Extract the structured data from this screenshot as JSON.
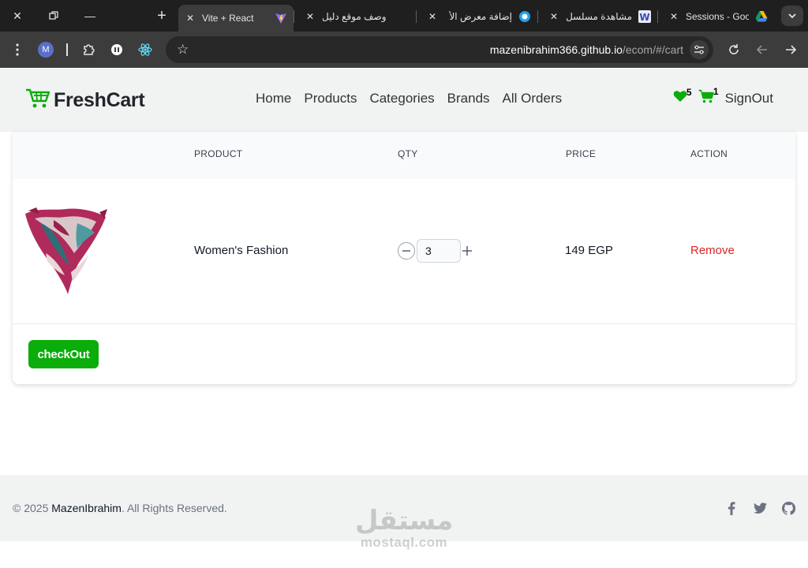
{
  "browser": {
    "tabs": [
      {
        "title": "Vite + React",
        "active": true
      },
      {
        "title": "وصف موقع دليل",
        "active": false
      },
      {
        "title": "إضافة معرض الأ",
        "active": false
      },
      {
        "title": "مشاهدة مسلسل",
        "active": false
      },
      {
        "title": "Sessions - Goo",
        "active": false
      }
    ],
    "new_tab_label": "+",
    "profile_initial": "M",
    "url_host": "mazenibrahim366.github.io",
    "url_path": "/ecom/#/cart"
  },
  "navbar": {
    "brand": "FreshCart",
    "links": [
      "Home",
      "Products",
      "Categories",
      "Brands",
      "All Orders"
    ],
    "wishlist_count": "5",
    "cart_count": "1",
    "signout": "SignOut",
    "accent": "#0aad0a"
  },
  "cart": {
    "headers": [
      "",
      "PRODUCT",
      "QTY",
      "PRICE",
      "ACTION"
    ],
    "items": [
      {
        "name": "Women's Fashion",
        "qty": "3",
        "price": "149 EGP",
        "action": "Remove"
      }
    ],
    "checkout_label": "checkOut"
  },
  "footer": {
    "copyright_prefix": "© 2025 ",
    "owner": "MazenIbrahim",
    "copyright_suffix": ". All Rights Reserved.",
    "socials": [
      "facebook-icon",
      "twitter-icon",
      "github-icon"
    ]
  },
  "watermark": {
    "arabic": "مستقل",
    "latin": "mostaql.com"
  }
}
